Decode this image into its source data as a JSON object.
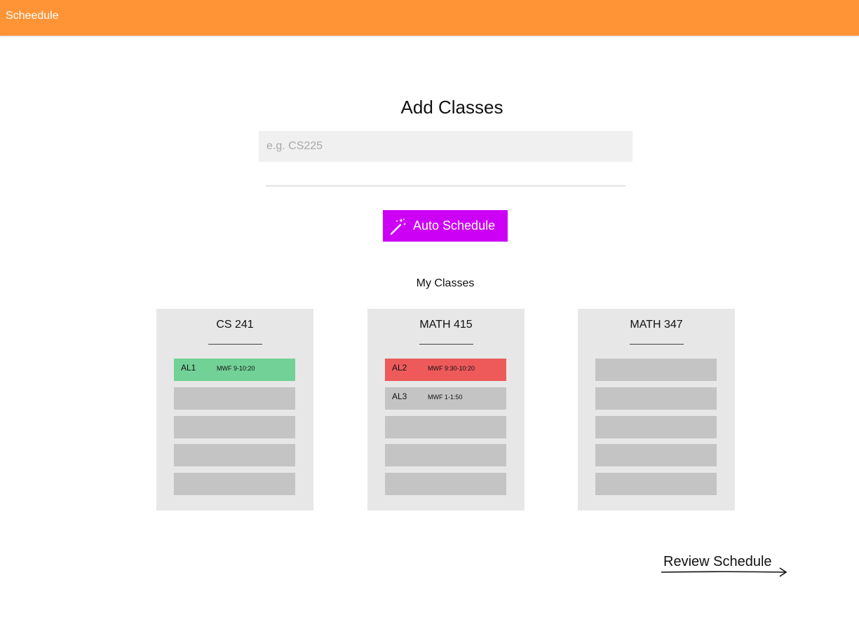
{
  "app": {
    "title": "Scheedule"
  },
  "main": {
    "title": "Add Classes",
    "search": {
      "placeholder": "e.g. CS225",
      "value": ""
    },
    "auto_button": {
      "label": "Auto Schedule",
      "icon": "magic-wand-icon",
      "color": "#cc00f5"
    },
    "my_classes_label": "My Classes",
    "review_link": {
      "label": "Review Schedule",
      "icon": "arrow-right-icon"
    }
  },
  "colors": {
    "header": "#ff9436",
    "selected_section": "#71d197",
    "conflict_section": "#ee5a5a",
    "empty_slot": "#c4c4c4",
    "card": "#e7e7e7"
  },
  "classes": [
    {
      "name": "CS 241",
      "sections": [
        {
          "code": "AL1",
          "time": "MWF 9-10:20",
          "status": "selected"
        },
        {
          "code": "",
          "time": "",
          "status": "empty"
        },
        {
          "code": "",
          "time": "",
          "status": "empty"
        },
        {
          "code": "",
          "time": "",
          "status": "empty"
        },
        {
          "code": "",
          "time": "",
          "status": "empty"
        }
      ]
    },
    {
      "name": "MATH 415",
      "sections": [
        {
          "code": "AL2",
          "time": "MWF 9:30-10:20",
          "status": "conflict"
        },
        {
          "code": "AL3",
          "time": "MWF 1-1:50",
          "status": "available"
        },
        {
          "code": "",
          "time": "",
          "status": "empty"
        },
        {
          "code": "",
          "time": "",
          "status": "empty"
        },
        {
          "code": "",
          "time": "",
          "status": "empty"
        }
      ]
    },
    {
      "name": "MATH 347",
      "sections": [
        {
          "code": "",
          "time": "",
          "status": "empty"
        },
        {
          "code": "",
          "time": "",
          "status": "empty"
        },
        {
          "code": "",
          "time": "",
          "status": "empty"
        },
        {
          "code": "",
          "time": "",
          "status": "empty"
        },
        {
          "code": "",
          "time": "",
          "status": "empty"
        }
      ]
    }
  ]
}
